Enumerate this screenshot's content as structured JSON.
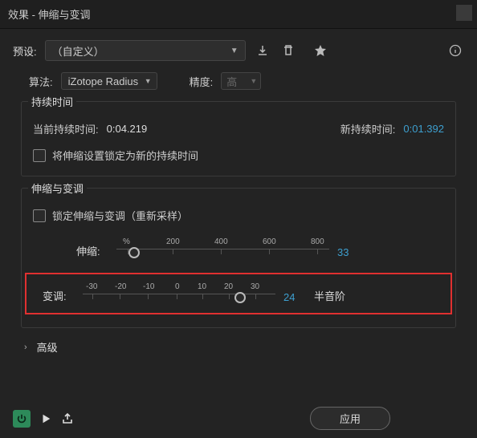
{
  "title": "效果 - 伸缩与变调",
  "preset": {
    "label": "预设:",
    "value": "（自定义）"
  },
  "icons": {
    "download": "download-icon",
    "trash": "trash-icon",
    "star": "star-icon",
    "info": "info-icon"
  },
  "algorithm": {
    "label": "算法:",
    "value": "iZotope Radius"
  },
  "precision": {
    "label": "精度:",
    "value": "高"
  },
  "duration": {
    "legend": "持续时间",
    "current_label": "当前持续时间:",
    "current_value": "0:04.219",
    "new_label": "新持续时间:",
    "new_value": "0:01.392",
    "lock_label": "将伸缩设置锁定为新的持续时间"
  },
  "stretch_pitch": {
    "legend": "伸缩与变调",
    "lock_label": "锁定伸缩与变调（重新采样）",
    "stretch": {
      "label": "伸缩:",
      "unit": "%",
      "ticks": [
        "200",
        "400",
        "600",
        "800"
      ],
      "value": "33"
    },
    "pitch": {
      "label": "变调:",
      "ticks": [
        "-30",
        "-20",
        "-10",
        "0",
        "10",
        "20",
        "30"
      ],
      "value": "24",
      "unit": "半音阶"
    }
  },
  "advanced": "高级",
  "footer": {
    "apply": "应用"
  }
}
